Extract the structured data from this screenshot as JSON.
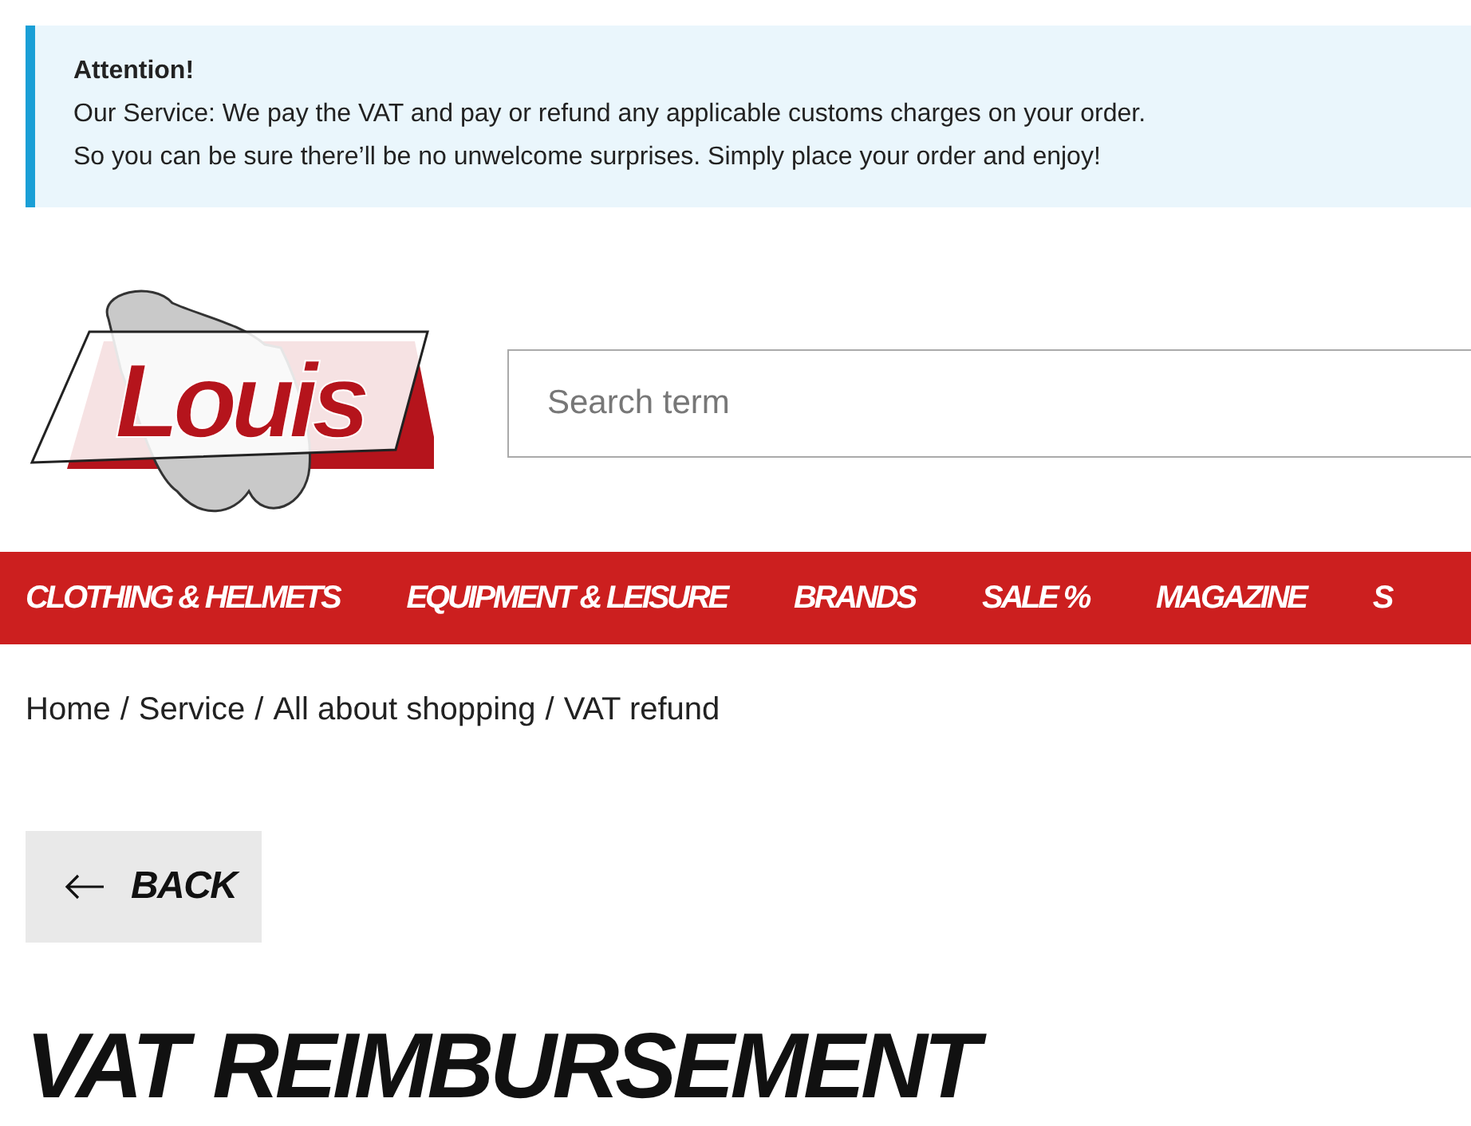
{
  "notice": {
    "title": "Attention!",
    "lines": [
      "Our Service: We pay the VAT and pay or refund any applicable customs charges on your order.",
      "So you can be sure there’ll be no unwelcome surprises. Simply place your order and enjoy!"
    ]
  },
  "logo": {
    "text": "Louis"
  },
  "search": {
    "placeholder": "Search term"
  },
  "nav": [
    {
      "label": "CLOTHING & HELMETS"
    },
    {
      "label": "EQUIPMENT & LEISURE"
    },
    {
      "label": "BRANDS"
    },
    {
      "label": "SALE %"
    },
    {
      "label": "MAGAZINE"
    },
    {
      "label": "S"
    }
  ],
  "breadcrumb": [
    {
      "label": "Home"
    },
    {
      "separator": "/",
      "label": "Service"
    },
    {
      "separator": "/",
      "label": "All about shopping"
    },
    {
      "separator": "/",
      "label": "VAT refund"
    }
  ],
  "back_button": {
    "label": "BACK"
  },
  "heading": "VAT REIMBURSEMENT"
}
